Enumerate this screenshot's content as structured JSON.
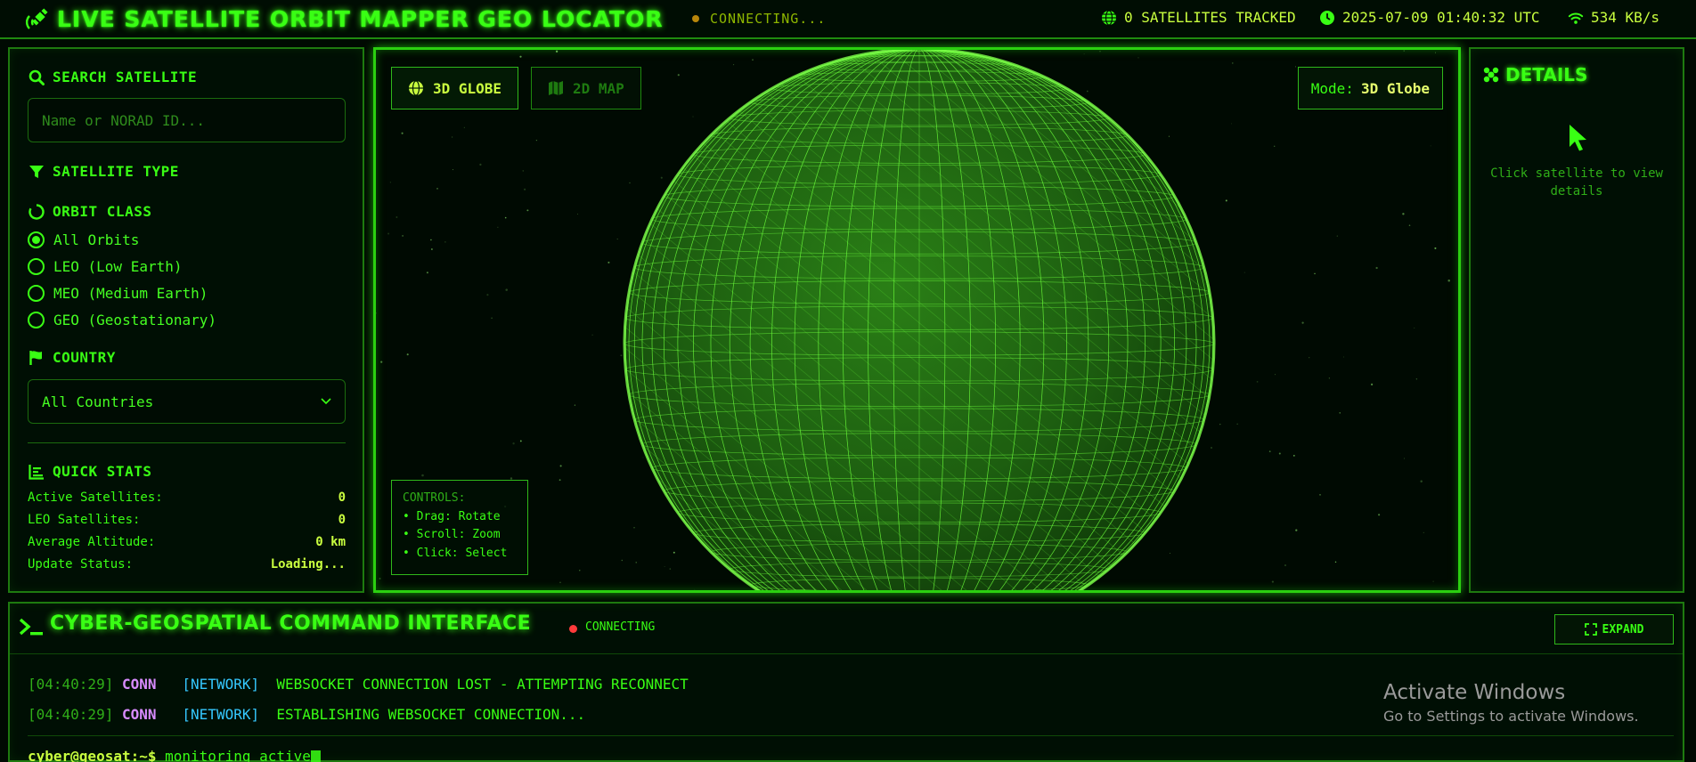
{
  "header": {
    "title": "LIVE SATELLITE ORBIT MAPPER GEO LOCATOR",
    "connection_status": "CONNECTING...",
    "satellites_tracked": "0 SATELLITES TRACKED",
    "datetime": "2025-07-09 01:40:32 UTC",
    "bandwidth": "534 KB/s"
  },
  "sidebar": {
    "search": {
      "heading": "SEARCH SATELLITE",
      "placeholder": "Name or NORAD ID...",
      "value": ""
    },
    "satellite_type_heading": "SATELLITE TYPE",
    "orbit_class": {
      "heading": "ORBIT CLASS",
      "options": [
        {
          "label": "All Orbits",
          "selected": true
        },
        {
          "label": "LEO (Low Earth)",
          "selected": false
        },
        {
          "label": "MEO (Medium Earth)",
          "selected": false
        },
        {
          "label": "GEO (Geostationary)",
          "selected": false
        }
      ]
    },
    "country": {
      "heading": "COUNTRY",
      "selected": "All Countries"
    },
    "quick_stats": {
      "heading": "QUICK STATS",
      "rows": [
        {
          "label": "Active Satellites:",
          "value": "0"
        },
        {
          "label": "LEO Satellites:",
          "value": "0"
        },
        {
          "label": "Average Altitude:",
          "value": "0 km"
        },
        {
          "label": "Update Status:",
          "value": "Loading..."
        }
      ]
    }
  },
  "viewer": {
    "btn_3d": "3D GLOBE",
    "btn_2d": "2D MAP",
    "mode_label": "Mode:",
    "mode_value": "3D Globe",
    "controls": {
      "title": "CONTROLS:",
      "items": [
        "• Drag: Rotate",
        "• Scroll: Zoom",
        "• Click: Select"
      ]
    }
  },
  "details": {
    "heading": "DETAILS",
    "hint": "Click satellite to view details"
  },
  "terminal": {
    "title": "CYBER-GEOSPATIAL COMMAND INTERFACE",
    "status": "CONNECTING",
    "expand_label": "EXPAND",
    "logs": [
      {
        "time": "[04:40:29]",
        "level": "CONN",
        "category": "[NETWORK]",
        "message": "WEBSOCKET CONNECTION LOST - ATTEMPTING RECONNECT"
      },
      {
        "time": "[04:40:29]",
        "level": "CONN",
        "category": "[NETWORK]",
        "message": "ESTABLISHING WEBSOCKET CONNECTION..."
      }
    ],
    "prompt_user": "cyber@geosat:~$",
    "prompt_text": "monitoring active"
  },
  "watermark": {
    "line1": "Activate Windows",
    "line2": "Go to Settings to activate Windows."
  },
  "colors": {
    "accent": "#39ff14",
    "highlight": "#c9ff3f",
    "status_dot": "#ff3b3b"
  }
}
